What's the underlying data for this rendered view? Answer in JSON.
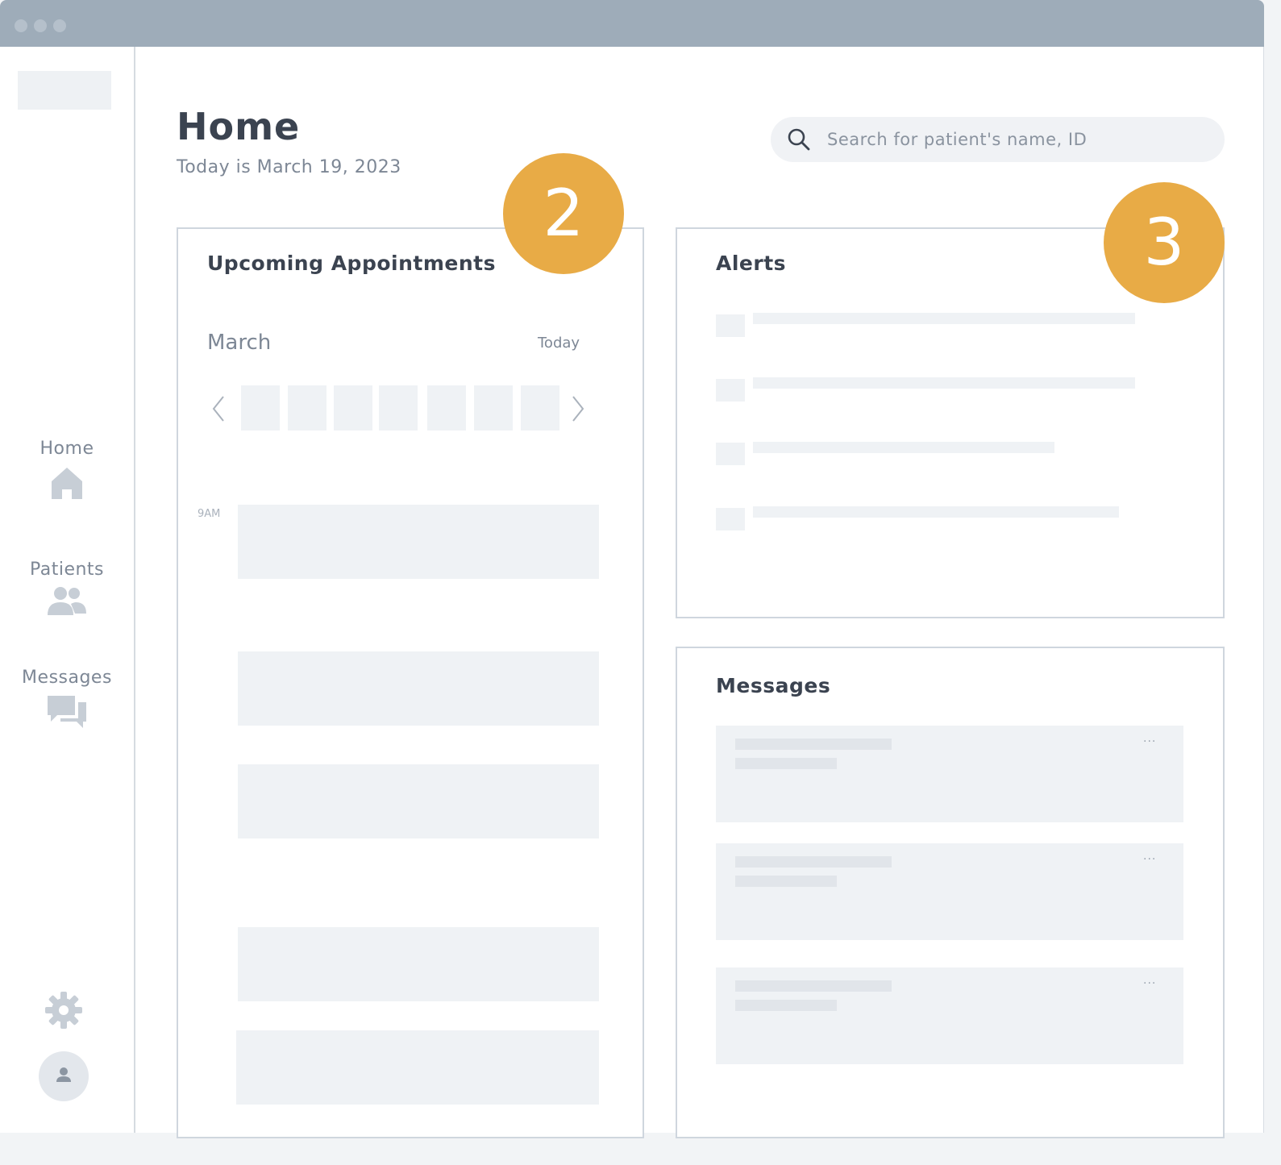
{
  "header": {
    "title": "Home",
    "date_text": "Today is March 19, 2023"
  },
  "search": {
    "placeholder": "Search for patient's name, ID"
  },
  "sidebar": {
    "items": [
      {
        "label": "Home",
        "icon": "home-icon"
      },
      {
        "label": "Patients",
        "icon": "patients-icon"
      },
      {
        "label": "Messages",
        "icon": "messages-icon"
      }
    ],
    "settings_icon": "gear-icon",
    "avatar_icon": "user-icon"
  },
  "appointments": {
    "title": "Upcoming Appointments",
    "month": "March",
    "today_label": "Today",
    "time_label": "9AM"
  },
  "alerts": {
    "title": "Alerts"
  },
  "messages": {
    "title": "Messages",
    "more_label": "···"
  },
  "annotations": {
    "badge_2": "2",
    "badge_3": "3"
  },
  "colors": {
    "badge": "#e8ab46",
    "titlebar": "#9eacb9",
    "placeholder_block": "#eff2f5"
  }
}
